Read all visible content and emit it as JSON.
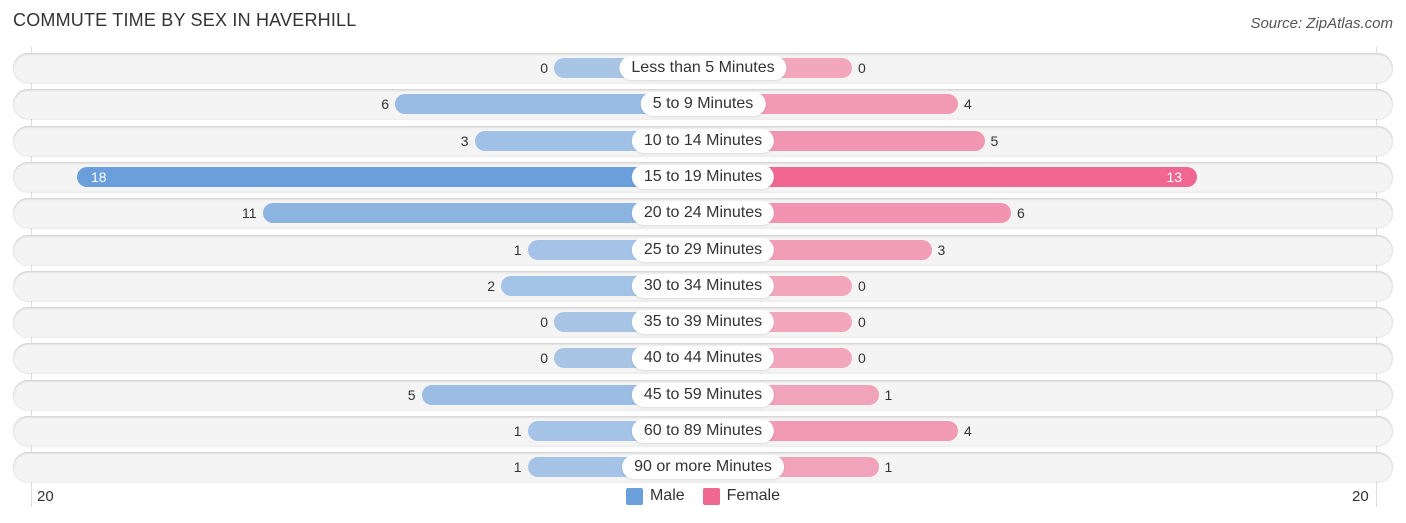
{
  "chart_data": {
    "type": "bar",
    "orientation": "horizontal-diverging",
    "title": "COMMUTE TIME BY SEX IN HAVERHILL",
    "source": "Source: ZipAtlas.com",
    "categories": [
      "Less than 5 Minutes",
      "5 to 9 Minutes",
      "10 to 14 Minutes",
      "15 to 19 Minutes",
      "20 to 24 Minutes",
      "25 to 29 Minutes",
      "30 to 34 Minutes",
      "35 to 39 Minutes",
      "40 to 44 Minutes",
      "45 to 59 Minutes",
      "60 to 89 Minutes",
      "90 or more Minutes"
    ],
    "series": [
      {
        "name": "Male",
        "color": "#6a9fdb",
        "values": [
          0,
          6,
          3,
          18,
          11,
          1,
          2,
          0,
          0,
          5,
          1,
          1
        ]
      },
      {
        "name": "Female",
        "color": "#f06792",
        "values": [
          0,
          4,
          5,
          13,
          6,
          3,
          0,
          0,
          0,
          1,
          4,
          1
        ]
      }
    ],
    "axis": {
      "left_tick": "20",
      "right_tick": "20",
      "max": 20
    },
    "legend": {
      "position": "bottom-center",
      "items": [
        {
          "label": "Male",
          "color": "#6a9fdb"
        },
        {
          "label": "Female",
          "color": "#f06792"
        }
      ]
    }
  }
}
